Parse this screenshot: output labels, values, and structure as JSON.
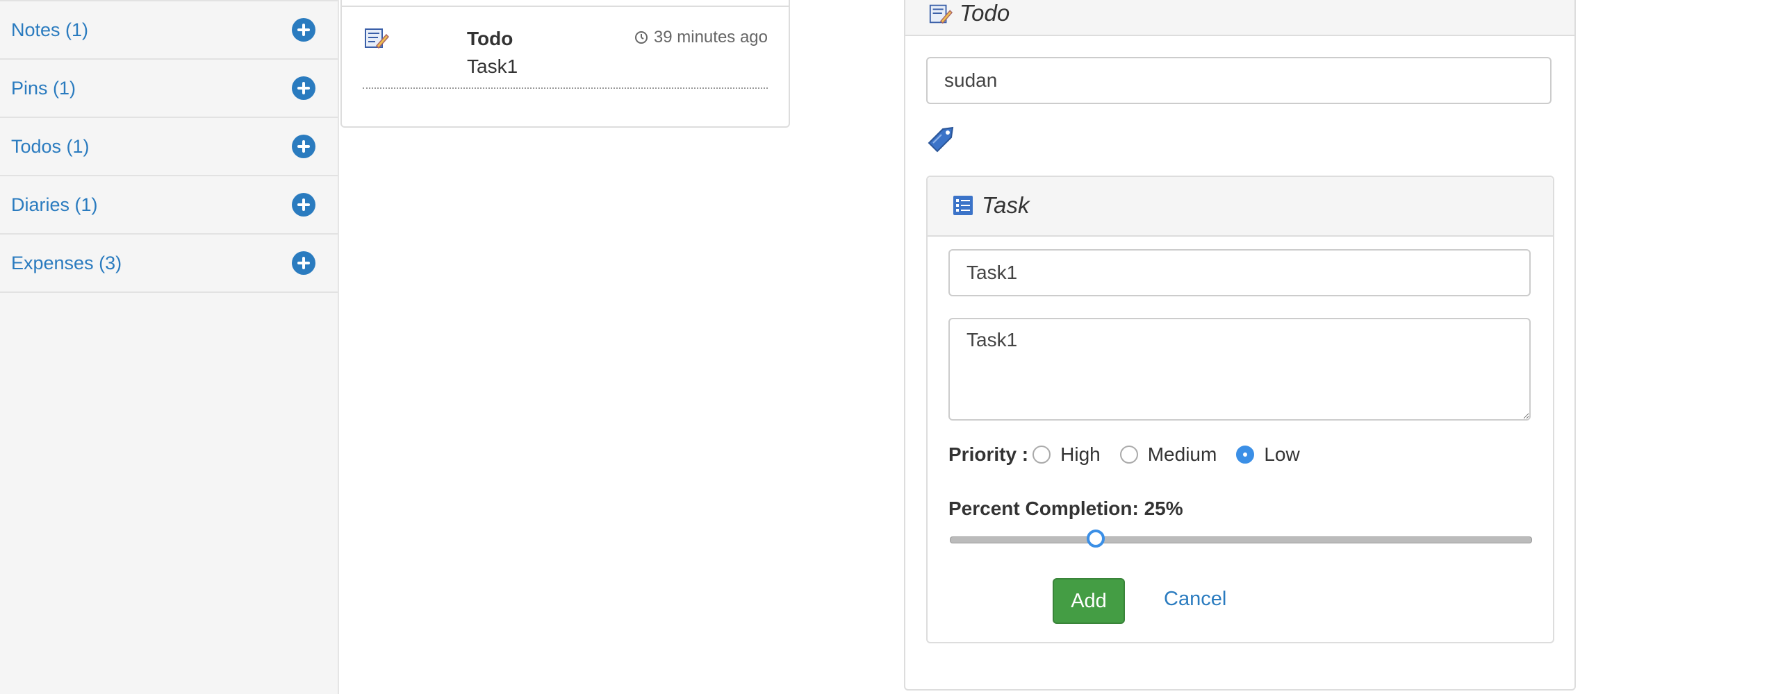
{
  "sidebar": {
    "items": [
      {
        "label": "Notes (1)"
      },
      {
        "label": "Pins (1)"
      },
      {
        "label": "Todos (1)"
      },
      {
        "label": "Diaries (1)"
      },
      {
        "label": "Expenses (3)"
      }
    ]
  },
  "list": {
    "item": {
      "title": "Todo",
      "text": "Task1",
      "time": "39 minutes ago",
      "icon": "todo-icon"
    }
  },
  "form": {
    "header_title": "Todo",
    "title_value": "sudan",
    "tag_icon": "tag-icon",
    "task": {
      "header_title": "Task",
      "name_value": "Task1",
      "description_value": "Task1",
      "priority_label": "Priority :",
      "priority_options": [
        "High",
        "Medium",
        "Low"
      ],
      "priority_selected": "Low",
      "percent_label": "Percent Completion: 25%",
      "percent_value": 25,
      "add_label": "Add",
      "cancel_label": "Cancel"
    }
  },
  "colors": {
    "link": "#2a7bbf",
    "success": "#449d44",
    "accent": "#3b8fe6"
  }
}
